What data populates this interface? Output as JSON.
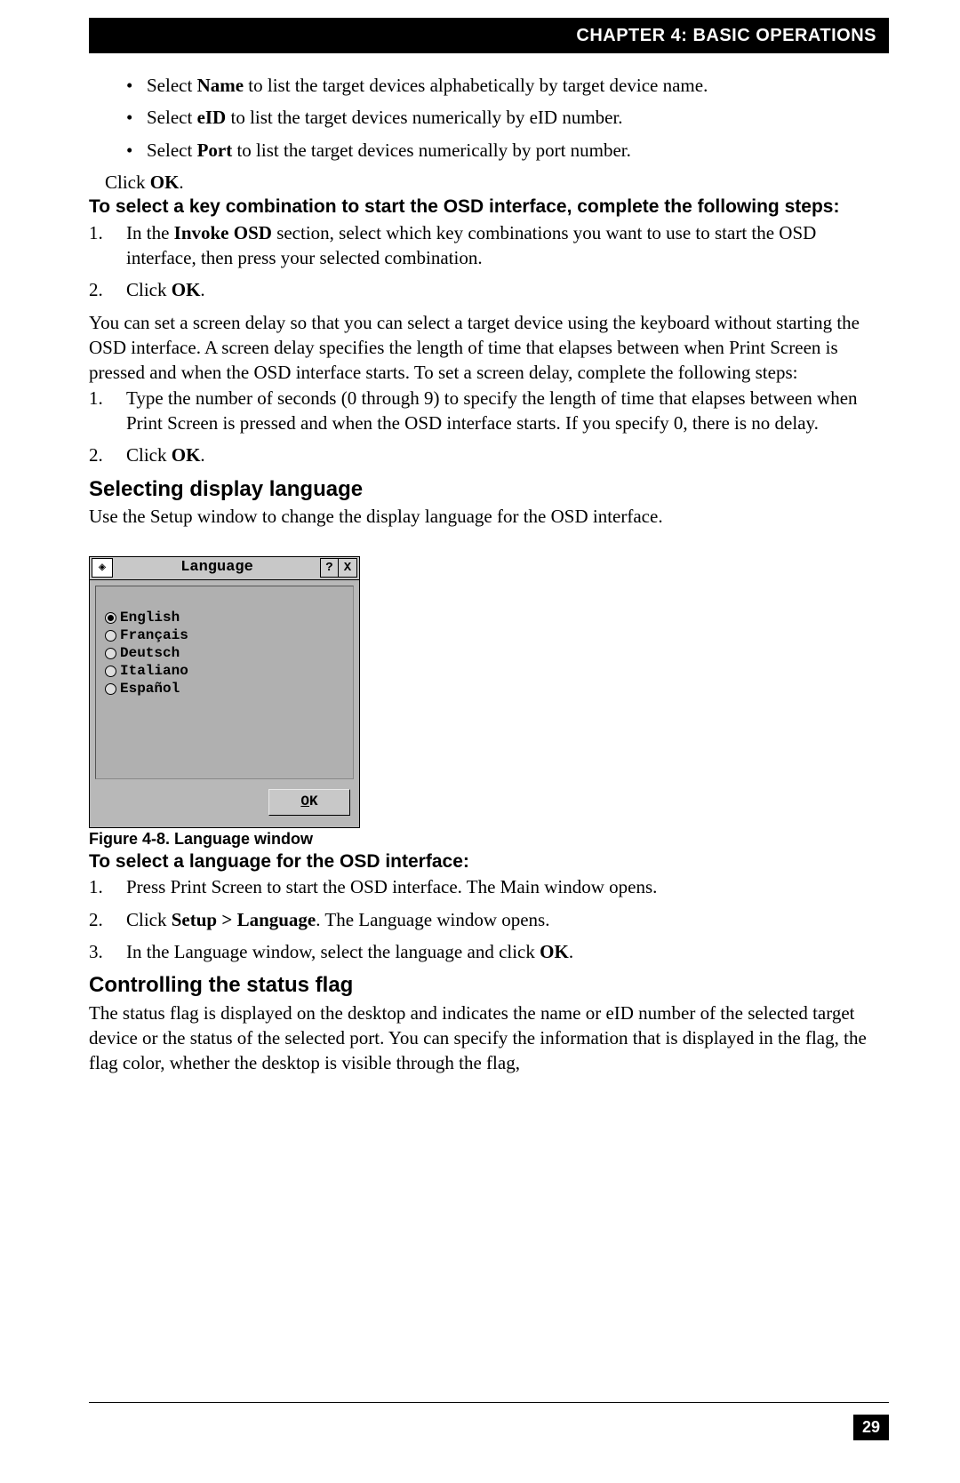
{
  "header": {
    "title": "CHAPTER 4: BASIC OPERATIONS"
  },
  "bullets": {
    "name": {
      "pre": "Select ",
      "bold": "Name",
      "post": " to list the target devices alphabetically by target device name."
    },
    "eid": {
      "pre": "Select ",
      "bold": "eID",
      "post": " to list the target devices numerically by eID number."
    },
    "port": {
      "pre": "Select ",
      "bold": "Port",
      "post": " to list the target devices numerically by port number."
    }
  },
  "click_ok": {
    "pre": "Click ",
    "bold": "OK",
    "post": "."
  },
  "osd_key_heading": "To select a key combination to start the OSD interface, complete the following steps:",
  "osd_key_steps": {
    "s1": {
      "pre": "In the ",
      "bold": "Invoke OSD",
      "post": " section, select which key combinations you want to use to start the OSD interface, then press your selected combination."
    },
    "s2": {
      "pre": "Click ",
      "bold": "OK",
      "post": "."
    }
  },
  "delay_intro": "You can set a screen delay so that you can select a target device using the keyboard without starting the OSD interface. A screen delay specifies the length of time that elapses between when Print Screen is pressed and when the OSD interface starts. To set a screen delay, complete the following steps:",
  "delay_steps": {
    "s1": "Type the number of seconds (0 through 9) to specify the length of time that elapses between when Print Screen is pressed and when the OSD interface starts. If you specify 0, there is no delay.",
    "s2": {
      "pre": "Click ",
      "bold": "OK",
      "post": "."
    }
  },
  "section_lang_heading": "Selecting display language",
  "section_lang_intro": "Use the Setup window to change the display language for the OSD interface.",
  "lang_window": {
    "title": "Language",
    "options": [
      "English",
      "Français",
      "Deutsch",
      "Italiano",
      "Español"
    ],
    "selected_index": 0,
    "ok_label": "OK",
    "help_label": "?",
    "close_label": "X"
  },
  "figure_caption": "Figure 4-8.  Language window",
  "lang_proc_heading": "To select a language for the OSD interface:",
  "lang_proc": {
    "s1": "Press Print Screen to start the OSD interface. The Main window opens.",
    "s2": {
      "pre": "Click ",
      "bold": "Setup > Language",
      "post": ". The Language window opens."
    },
    "s3": {
      "pre": "In the Language window, select the language and click ",
      "bold": "OK",
      "post": "."
    }
  },
  "section_flag_heading": "Controlling the status flag",
  "section_flag_body": "The status flag is displayed on the desktop and indicates the name or eID number of the selected target device or the status of the selected port. You can specify the information that is displayed in the flag, the flag color, whether the desktop is visible through the flag,",
  "page_number": "29"
}
